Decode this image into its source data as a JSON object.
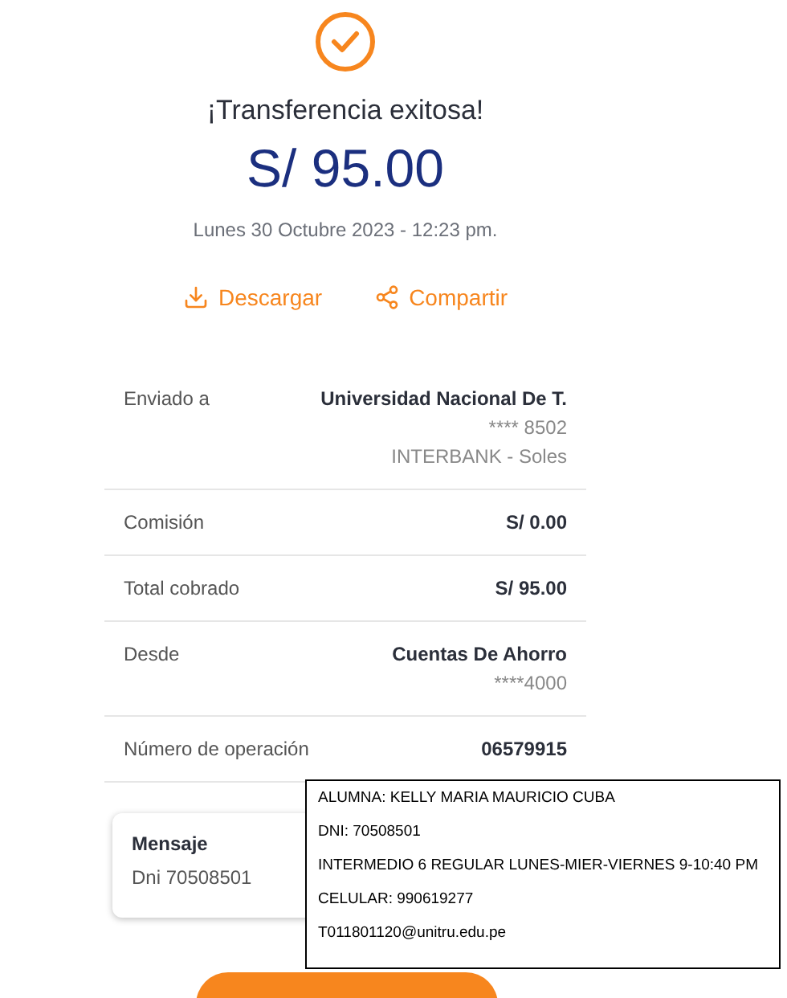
{
  "status": {
    "title": "¡Transferencia exitosa!",
    "amount": "S/ 95.00",
    "date": "Lunes 30 Octubre 2023 - 12:23 pm."
  },
  "actions": [
    {
      "kind": "download",
      "label": "Descargar"
    },
    {
      "kind": "share",
      "label": "Compartir"
    }
  ],
  "details": [
    {
      "label": "Enviado a",
      "value": "Universidad Nacional De T.",
      "extra": [
        "**** 8502",
        "INTERBANK - Soles"
      ]
    },
    {
      "label": "Comisión",
      "value": "S/ 0.00"
    },
    {
      "label": "Total cobrado",
      "value": "S/ 95.00"
    },
    {
      "label": "Desde",
      "value": "Cuentas De Ahorro",
      "extra": [
        "****4000"
      ]
    },
    {
      "label": "Número de operación",
      "value": "06579915"
    }
  ],
  "message": {
    "title": "Mensaje",
    "text": "Dni 70508501"
  },
  "note": [
    "ALUMNA: KELLY MARIA MAURICIO CUBA",
    "DNI: 70508501",
    "INTERMEDIO 6 REGULAR LUNES-MIER-VIERNES 9-10:40 PM",
    "CELULAR: 990619277",
    "T011801120@unitru.edu.pe"
  ]
}
